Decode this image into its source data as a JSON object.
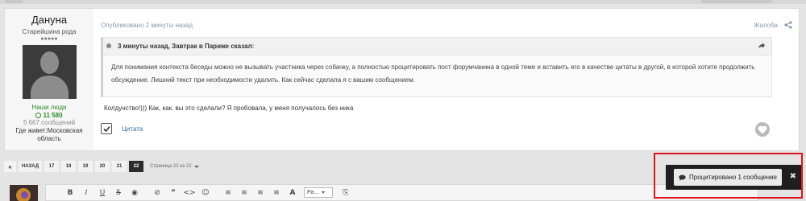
{
  "post": {
    "author": {
      "name": "Дануна",
      "rank": "Старейшина рода",
      "pips": "●●●●●",
      "group": "Наши люди",
      "reputation": "11 580",
      "posts_count": "5 667 сообщений",
      "location": "Где живет:Московская область"
    },
    "date": "Опубликовано 2 минуты назад",
    "report": "Жалоба",
    "quote": {
      "header": "3 минуты назад, Завтрак в Париже сказал:",
      "body": "Для понимания контекста беседы можно не вызывать участника через собачку, а полностью процитировать пост форумчанина в одной теме и вставить его в качестве цитаты в другой, в которой хотите продолжить обсуждение. Лишний текст при необходимости удалить. Как сейчас сделала я с вашим сообщением."
    },
    "text": "Колдунство!))) Как, как. вы это сделали? Я пробовала, у меня получалось без ника",
    "quote_action": "Цитата"
  },
  "pagination": {
    "prev_icon": "«",
    "back": "НАЗАД",
    "pages": [
      "17",
      "18",
      "19",
      "20",
      "21",
      "22"
    ],
    "active_page": "22",
    "label": "Страница 22 из 22"
  },
  "editor": {
    "tools": [
      {
        "icon": "bold-icon",
        "glyph": "B"
      },
      {
        "icon": "italic-icon",
        "glyph": "I"
      },
      {
        "icon": "underline-icon",
        "glyph": "U"
      },
      {
        "icon": "strikethrough-icon",
        "glyph": "S"
      },
      {
        "icon": "eye-icon",
        "glyph": "◉"
      },
      {
        "icon": "link-icon",
        "glyph": "⊘"
      },
      {
        "icon": "quote-icon",
        "glyph": "”"
      },
      {
        "icon": "code-icon",
        "glyph": "<>"
      },
      {
        "icon": "emoji-icon",
        "glyph": "☺"
      },
      {
        "icon": "list-icon",
        "glyph": "≡"
      },
      {
        "icon": "align-left-icon",
        "glyph": "≡"
      },
      {
        "icon": "align-center-icon",
        "glyph": "≡"
      },
      {
        "icon": "align-right-icon",
        "glyph": "≡"
      },
      {
        "icon": "font-size-icon",
        "glyph": "A"
      }
    ],
    "font_select": "Ра...",
    "last_tool": {
      "icon": "preview-icon",
      "glyph": "⎘"
    }
  },
  "toast": {
    "label": "Процитировано 1 сообщение",
    "close": "✖"
  },
  "colors": {
    "highlight": "#e0141e",
    "link": "#3a6ea5",
    "group": "#2e8b2e",
    "toast_bg": "#1f1f1f"
  }
}
